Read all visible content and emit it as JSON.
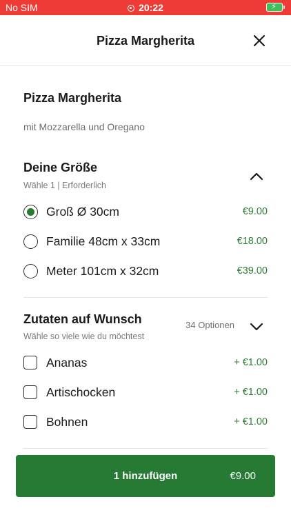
{
  "status_bar": {
    "carrier": "No SIM",
    "time": "20:22",
    "battery_icon": "battery-charging-icon",
    "battery_color": "#3fbf5a"
  },
  "header": {
    "title": "Pizza Margherita",
    "close_icon": "close-icon"
  },
  "product": {
    "name": "Pizza Margherita",
    "description": "mit Mozzarella und Oregano"
  },
  "size_section": {
    "title": "Deine Größe",
    "subtitle": "Wähle 1  |  Erforderlich",
    "expanded": true,
    "options": [
      {
        "label": "Groß Ø 30cm",
        "price": "€9.00",
        "selected": true
      },
      {
        "label": "Familie 48cm x 33cm",
        "price": "€18.00",
        "selected": false
      },
      {
        "label": "Meter 101cm x 32cm",
        "price": "€39.00",
        "selected": false
      }
    ]
  },
  "extras_section": {
    "title": "Zutaten auf Wunsch",
    "subtitle": "Wähle so viele wie du möchtest",
    "options_count": "34 Optionen",
    "expanded": false,
    "options": [
      {
        "label": "Ananas",
        "price": "+ €1.00",
        "checked": false
      },
      {
        "label": "Artischocken",
        "price": "+ €1.00",
        "checked": false
      },
      {
        "label": "Bohnen",
        "price": "+ €1.00",
        "checked": false
      }
    ]
  },
  "add_button": {
    "label": "1 hinzufügen",
    "amount": "€9.00"
  },
  "colors": {
    "status_bar": "#ee3b36",
    "accent_green": "#267a33",
    "price_green": "#2e7d32"
  }
}
